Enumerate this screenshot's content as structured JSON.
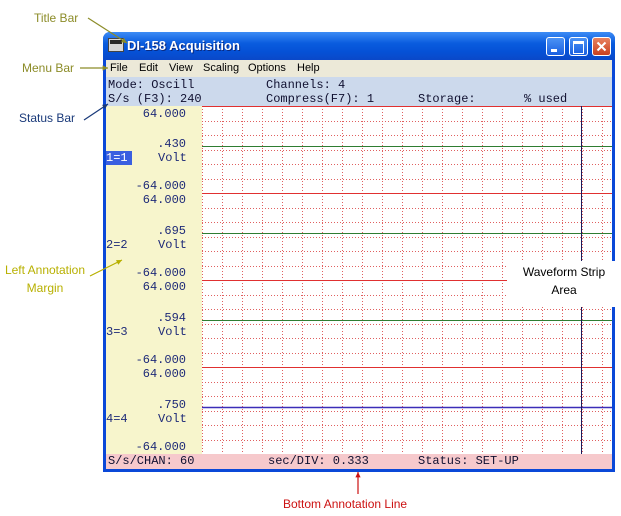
{
  "callouts": {
    "title_bar": "Title Bar",
    "menu_bar": "Menu Bar",
    "status_bar": "Status Bar",
    "left_margin_line1": "Left Annotation",
    "left_margin_line2": "Margin",
    "waveform_line1": "Waveform Strip",
    "waveform_line2": "Area",
    "bottom_line": "Bottom Annotation Line"
  },
  "colors": {
    "callout_olive": "#8c8c28",
    "callout_yellow": "#b8b000",
    "callout_blue": "#1a3a7a",
    "callout_red": "#cc1111",
    "grid": "#e06060",
    "separator": "#e03030",
    "trace_green": "#2e7d32",
    "trace_purple": "#3b2db8",
    "cursor_line": "#1a1a5a"
  },
  "window": {
    "title": "DI-158 Acquisition",
    "icon": "app-icon",
    "buttons": [
      "minimize-icon",
      "maximize-icon",
      "close-icon"
    ]
  },
  "menu": {
    "items": [
      "File",
      "Edit",
      "View",
      "Scaling",
      "Options",
      "Help"
    ]
  },
  "status": {
    "mode": "Mode: Oscill",
    "channels": "Channels: 4",
    "sample_rate": "S/s (F3): 240",
    "compress": "Compress(F7): 1",
    "storage": "Storage:",
    "used": "% used"
  },
  "channels": [
    {
      "top": "64.000",
      "value": ".430",
      "label": "1=1",
      "unit": "Volt",
      "bottom": "-64.000",
      "level": 0.43
    },
    {
      "top": "64.000",
      "value": ".695",
      "label": "2=2",
      "unit": "Volt",
      "bottom": "-64.000",
      "level": 0.695
    },
    {
      "top": "64.000",
      "value": ".594",
      "label": "3=3",
      "unit": "Volt",
      "bottom": "-64.000",
      "level": 0.594
    },
    {
      "top": "64.000",
      "value": ".750",
      "label": "4=4",
      "unit": "Volt",
      "bottom": "-64.000",
      "level": 0.75
    }
  ],
  "bottom_line": {
    "rate": "S/s/CHAN: 60",
    "secdiv": "sec/DIV: 0.333",
    "status": "Status: SET-UP"
  }
}
